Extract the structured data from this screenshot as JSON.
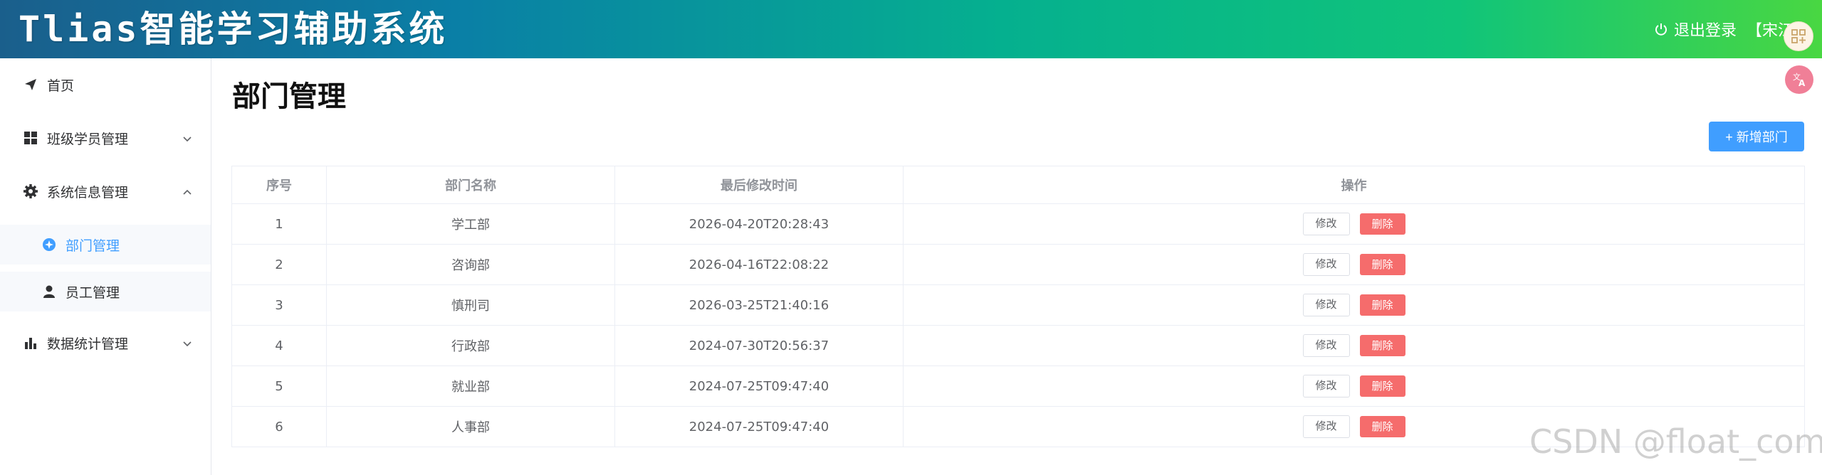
{
  "header": {
    "title": "Tlias智能学习辅助系统",
    "logout_label": "退出登录",
    "user_label": "【宋江"
  },
  "sidebar": {
    "items": [
      {
        "label": "首页",
        "icon": "paper-plane-icon"
      },
      {
        "label": "班级学员管理",
        "icon": "grid-icon"
      },
      {
        "label": "系统信息管理",
        "icon": "gear-icon"
      },
      {
        "label": "数据统计管理",
        "icon": "bar-chart-icon"
      }
    ],
    "sub_items": [
      {
        "label": "部门管理",
        "icon": "compass-icon",
        "active": true
      },
      {
        "label": "员工管理",
        "icon": "user-icon",
        "active": false
      }
    ]
  },
  "main": {
    "page_title": "部门管理",
    "add_button_label": "+ 新增部门",
    "table": {
      "headers": [
        "序号",
        "部门名称",
        "最后修改时间",
        "操作"
      ],
      "rows": [
        {
          "idx": "1",
          "name": "学工部",
          "time": "2026-04-20T20:28:43"
        },
        {
          "idx": "2",
          "name": "咨询部",
          "time": "2026-04-16T22:08:22"
        },
        {
          "idx": "3",
          "name": "慎刑司",
          "time": "2026-03-25T21:40:16"
        },
        {
          "idx": "4",
          "name": "行政部",
          "time": "2024-07-30T20:56:37"
        },
        {
          "idx": "5",
          "name": "就业部",
          "time": "2024-07-25T09:47:40"
        },
        {
          "idx": "6",
          "name": "人事部",
          "time": "2024-07-25T09:47:40"
        }
      ],
      "edit_label": "修改",
      "delete_label": "删除"
    }
  },
  "watermark": "CSDN @float_com",
  "colors": {
    "accent": "#409eff",
    "danger": "#f56c6c"
  }
}
